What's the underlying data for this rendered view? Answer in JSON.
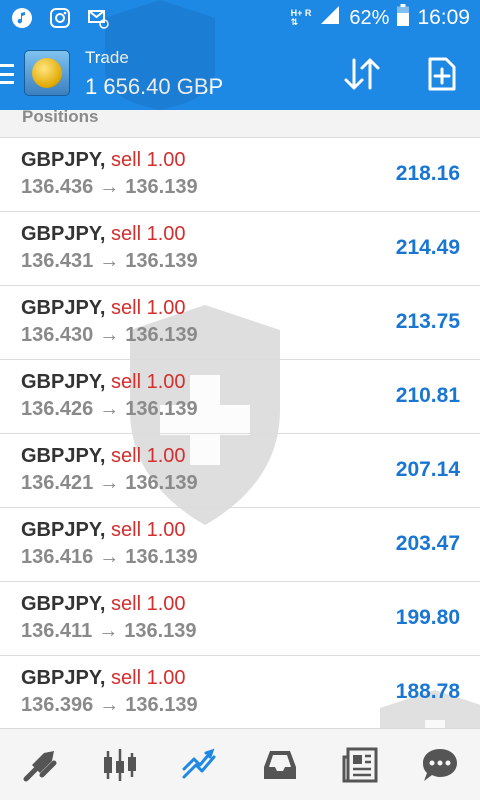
{
  "status_bar": {
    "network_top": "H+ R",
    "network_bottom": "⇅",
    "battery": "62%",
    "time": "16:09"
  },
  "header": {
    "title": "Trade",
    "balance": "1 656.40 GBP"
  },
  "section": {
    "title": "Positions"
  },
  "positions": [
    {
      "symbol": "GBPJPY,",
      "side": "sell 1.00",
      "open": "136.436",
      "arrow": "→",
      "current": "136.139",
      "profit": "218.16"
    },
    {
      "symbol": "GBPJPY,",
      "side": "sell 1.00",
      "open": "136.431",
      "arrow": "→",
      "current": "136.139",
      "profit": "214.49"
    },
    {
      "symbol": "GBPJPY,",
      "side": "sell 1.00",
      "open": "136.430",
      "arrow": "→",
      "current": "136.139",
      "profit": "213.75"
    },
    {
      "symbol": "GBPJPY,",
      "side": "sell 1.00",
      "open": "136.426",
      "arrow": "→",
      "current": "136.139",
      "profit": "210.81"
    },
    {
      "symbol": "GBPJPY,",
      "side": "sell 1.00",
      "open": "136.421",
      "arrow": "→",
      "current": "136.139",
      "profit": "207.14"
    },
    {
      "symbol": "GBPJPY,",
      "side": "sell 1.00",
      "open": "136.416",
      "arrow": "→",
      "current": "136.139",
      "profit": "203.47"
    },
    {
      "symbol": "GBPJPY,",
      "side": "sell 1.00",
      "open": "136.411",
      "arrow": "→",
      "current": "136.139",
      "profit": "199.80"
    },
    {
      "symbol": "GBPJPY,",
      "side": "sell 1.00",
      "open": "136.396",
      "arrow": "→",
      "current": "136.139",
      "profit": "188.78"
    }
  ],
  "colors": {
    "accent": "#1e88e5",
    "sell": "#d32f2f",
    "profit": "#1976d2",
    "muted": "#8a8a8a"
  },
  "icons": {
    "status": [
      "music-note-icon",
      "instagram-icon",
      "message-icon",
      "signal-icon",
      "battery-icon"
    ],
    "header": [
      "menu-icon",
      "mt-logo-icon",
      "sort-icon",
      "new-order-icon"
    ],
    "nav": [
      "quotes-icon",
      "chart-icon",
      "trade-icon",
      "history-icon",
      "news-icon",
      "chat-icon"
    ]
  }
}
